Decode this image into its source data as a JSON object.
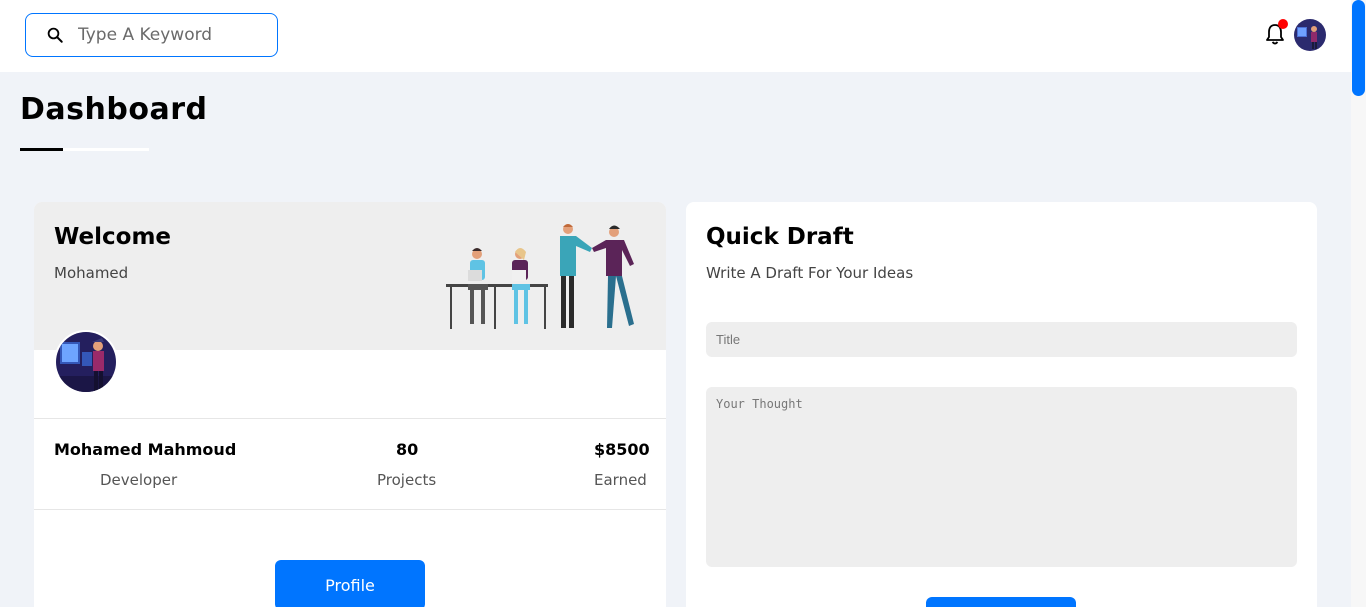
{
  "header": {
    "search_placeholder": "Type A Keyword",
    "notification_dot_color": "#ff0000"
  },
  "page": {
    "title": "Dashboard"
  },
  "welcome": {
    "title": "Welcome",
    "name": "Mohamed",
    "profile": {
      "full_name": "Mohamed Mahmoud",
      "role": "Developer",
      "projects_value": "80",
      "projects_label": "Projects",
      "earned_value": "$8500",
      "earned_label": "Earned"
    },
    "button_label": "Profile"
  },
  "draft": {
    "title": "Quick Draft",
    "subtitle": "Write A Draft For Your Ideas",
    "title_placeholder": "Title",
    "thought_placeholder": "Your Thought"
  },
  "colors": {
    "accent": "#0075ff",
    "background": "#f0f3f8"
  }
}
